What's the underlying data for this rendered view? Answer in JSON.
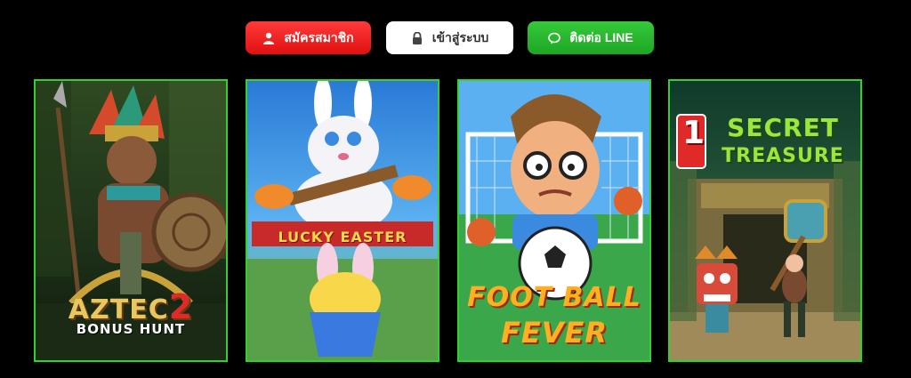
{
  "header": {
    "register_label": "สมัครสมาชิก",
    "login_label": "เข้าสู่ระบบ",
    "line_label": "ติดต่อ LINE"
  },
  "games": [
    {
      "title_line1": "AZTEC",
      "title_num": "2",
      "title_line2": "BONUS HUNT"
    },
    {
      "title": "LUCKY EASTER"
    },
    {
      "title_line1": "FOOT BALL",
      "title_line2": "FEVER"
    },
    {
      "title_num": "1",
      "title_line1": "SECRET",
      "title_line2": "TREASURE"
    }
  ],
  "colors": {
    "accent_border": "#33d12e",
    "register_bg": "#ff2d2d",
    "line_bg": "#2db832"
  }
}
